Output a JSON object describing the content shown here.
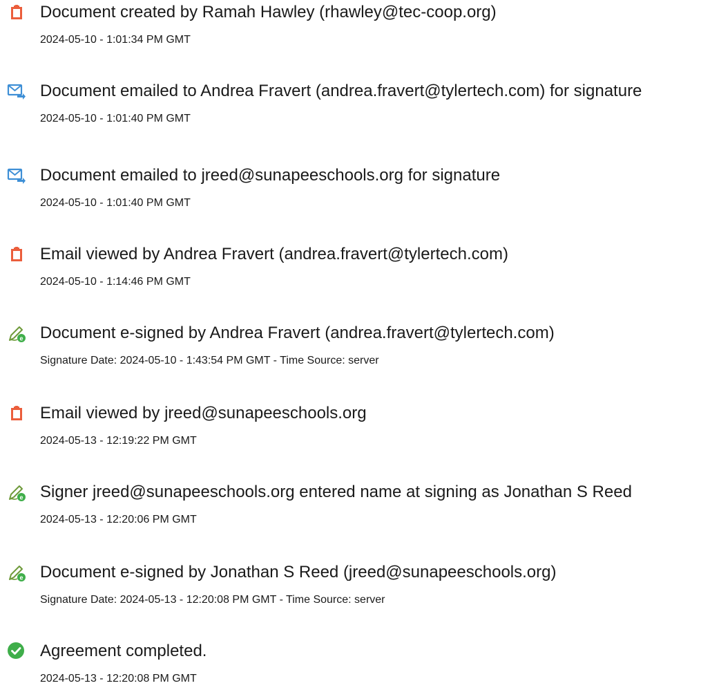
{
  "events": [
    {
      "icon": "document-icon",
      "title": "Document created by Ramah Hawley (rhawley@tec-coop.org)",
      "detail": "2024-05-10 - 1:01:34 PM GMT"
    },
    {
      "icon": "email-sent-icon",
      "title": "Document emailed to Andrea Fravert (andrea.fravert@tylertech.com) for signature",
      "detail": "2024-05-10 - 1:01:40 PM GMT"
    },
    {
      "icon": "email-sent-icon",
      "title": "Document emailed to jreed@sunapeeschools.org for signature",
      "detail": "2024-05-10 - 1:01:40 PM GMT"
    },
    {
      "icon": "document-icon",
      "title": "Email viewed by Andrea Fravert (andrea.fravert@tylertech.com)",
      "detail": "2024-05-10 - 1:14:46 PM GMT"
    },
    {
      "icon": "esign-pen-icon",
      "title": "Document e-signed by Andrea Fravert (andrea.fravert@tylertech.com)",
      "detail": "Signature Date: 2024-05-10 - 1:43:54 PM GMT - Time Source: server"
    },
    {
      "icon": "document-icon",
      "title": "Email viewed by jreed@sunapeeschools.org",
      "detail": "2024-05-13 - 12:19:22 PM GMT"
    },
    {
      "icon": "esign-pen-icon",
      "title": "Signer jreed@sunapeeschools.org entered name at signing as Jonathan S Reed",
      "detail": "2024-05-13 - 12:20:06 PM GMT"
    },
    {
      "icon": "esign-pen-icon",
      "title": "Document e-signed by Jonathan S Reed (jreed@sunapeeschools.org)",
      "detail": "Signature Date: 2024-05-13 - 12:20:08 PM GMT - Time Source: server"
    },
    {
      "icon": "checkmark-circle-icon",
      "title": "Agreement completed.",
      "detail": "2024-05-13 - 12:20:08 PM GMT"
    }
  ],
  "colors": {
    "document_icon": "#EB5E3C",
    "email_icon": "#3E8FD6",
    "pen_icon": "#6E9A3A",
    "check_icon": "#3FAE4A"
  }
}
